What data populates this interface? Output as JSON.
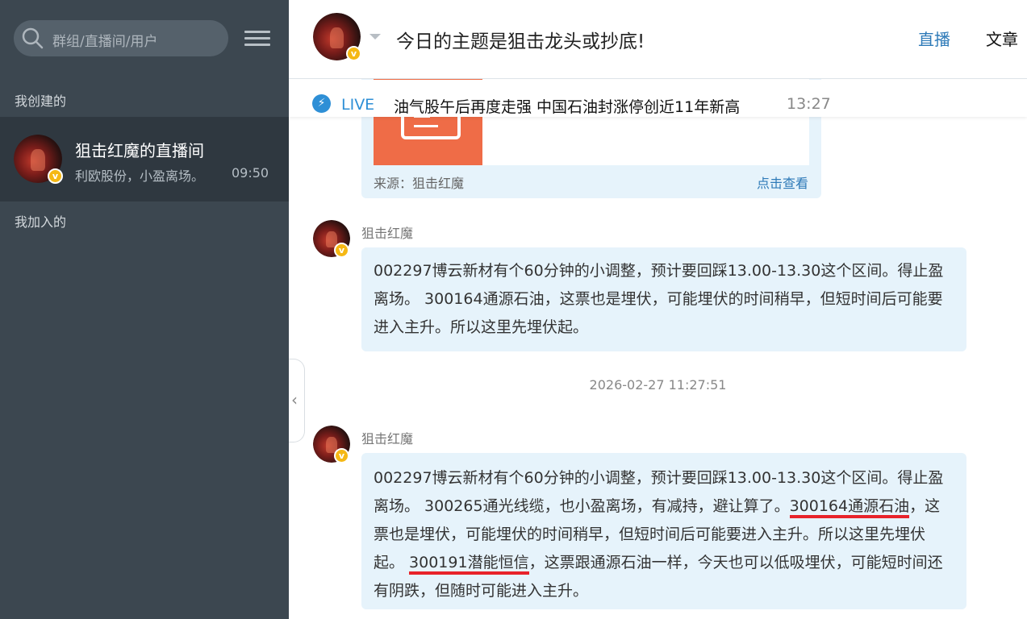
{
  "sidebar": {
    "search_placeholder": "群组/直播间/用户",
    "created_label": "我创建的",
    "joined_label": "我加入的",
    "room": {
      "title": "狙击红魔的直播间",
      "preview": "利欧股份，小盈离场。",
      "time": "09:50"
    }
  },
  "header": {
    "title": "今日的主题是狙击龙头或抄底!",
    "tabs": {
      "live": "直播",
      "article": "文章"
    }
  },
  "live_bar": {
    "label": "LIVE",
    "text": "油气股午后再度走强 中国石油封涨停创近11年新高",
    "time": "13:27"
  },
  "feed": {
    "card": {
      "source": "来源：狙击红魔",
      "view_link": "点击查看"
    },
    "timestamp": "2026-02-27 11:27:51",
    "messages": [
      {
        "author": "狙击红魔",
        "text": "002297博云新材有个60分钟的小调整，预计要回踩13.00-13.30这个区间。得止盈离场。 300164通源石油，这票也是埋伏，可能埋伏的时间稍早，但短时间后可能要进入主升。所以这里先埋伏起。"
      },
      {
        "author": "狙击红魔",
        "parts": {
          "p1": "002297博云新材有个60分钟的小调整，预计要回踩13.00-13.30这个区间。得止盈离场。 300265通光线缆，也小盈离场，有减持，避让算了。",
          "hl1": "300164通源石油",
          "p2": "，这票也是埋伏，可能埋伏的时间稍早，但短时间后可能要进入主升。所以这里先埋伏起。 ",
          "hl2": "300191潜能恒信",
          "p3": "，这票跟通源石油一样，今天也可以低吸埋伏，可能短时间还有阴跌，但随时可能进入主升。"
        }
      }
    ]
  },
  "colors": {
    "sidebar_bg": "#3c4750",
    "selected_bg": "#2f3840",
    "accent_blue": "#2e7ab8",
    "bubble_bg": "#e6f3fb",
    "highlight_red": "#e8232a",
    "badge_gold": "#f5b814"
  },
  "icons": [
    "search-icon",
    "menu-icon",
    "verified-badge-icon",
    "dropdown-caret-icon",
    "lightning-icon",
    "article-icon",
    "chevron-left-icon"
  ]
}
